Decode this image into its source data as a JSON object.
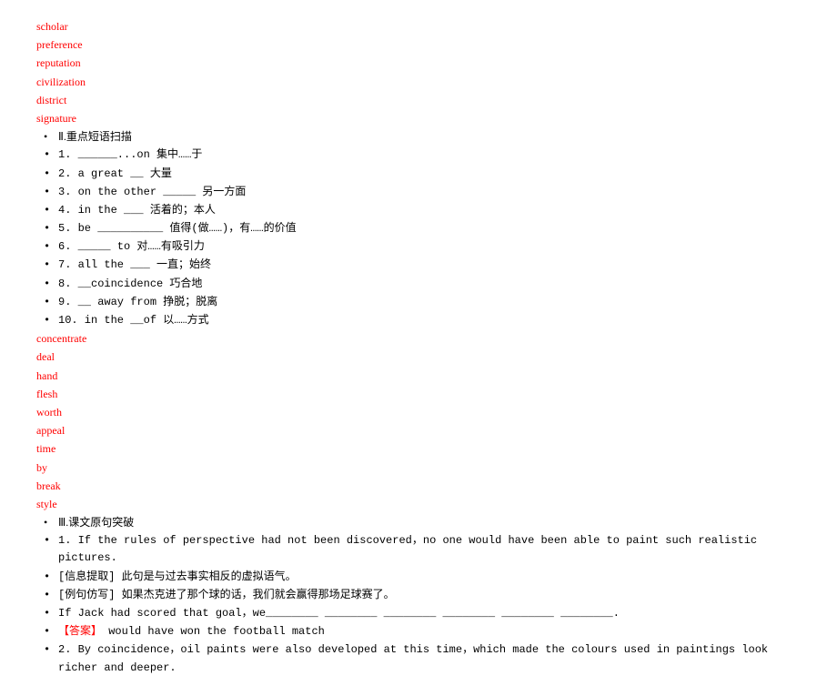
{
  "vocab1": {
    "items": [
      "scholar",
      "preference",
      "reputation",
      "civilization",
      "district",
      "signature"
    ]
  },
  "section2": {
    "header": "Ⅱ.重点短语扫描",
    "items": [
      "1. ______...on     集中……于",
      "2. a great __       大量",
      "3. on the other _____     另一方面",
      "4. in the ___       活着的；本人",
      "5. be __________       值得(做……)，有……的价值",
      "6. _____ to          对……有吸引力",
      "7. all the ___      一直；始终",
      "8. __coincidence       巧合地",
      "9. __ away from       挣脱；脱离",
      "10. in the __of       以……方式"
    ]
  },
  "vocab2": {
    "items": [
      "concentrate",
      "deal",
      "hand",
      "flesh",
      "worth",
      "appeal",
      "time",
      "by",
      "break",
      "style"
    ]
  },
  "section3": {
    "header": "Ⅲ.课文原句突破",
    "line1": "1. If the rules of perspective had not been discovered，no one would have been able to paint such realistic pictures.",
    "line2": "[信息提取]  此句是与过去事实相反的虚拟语气。",
    "line3": "[例句仿写]  如果杰克进了那个球的话，我们就会赢得那场足球赛了。",
    "line4": "If Jack had scored that goal，we________ ________ ________ ________ ________ ________.",
    "answer_label": "【答案】",
    "answer_text": "  would have won the football match",
    "line6": "2. By coincidence，oil paints were also developed at this time，which made the colours used in paintings look richer and deeper."
  }
}
